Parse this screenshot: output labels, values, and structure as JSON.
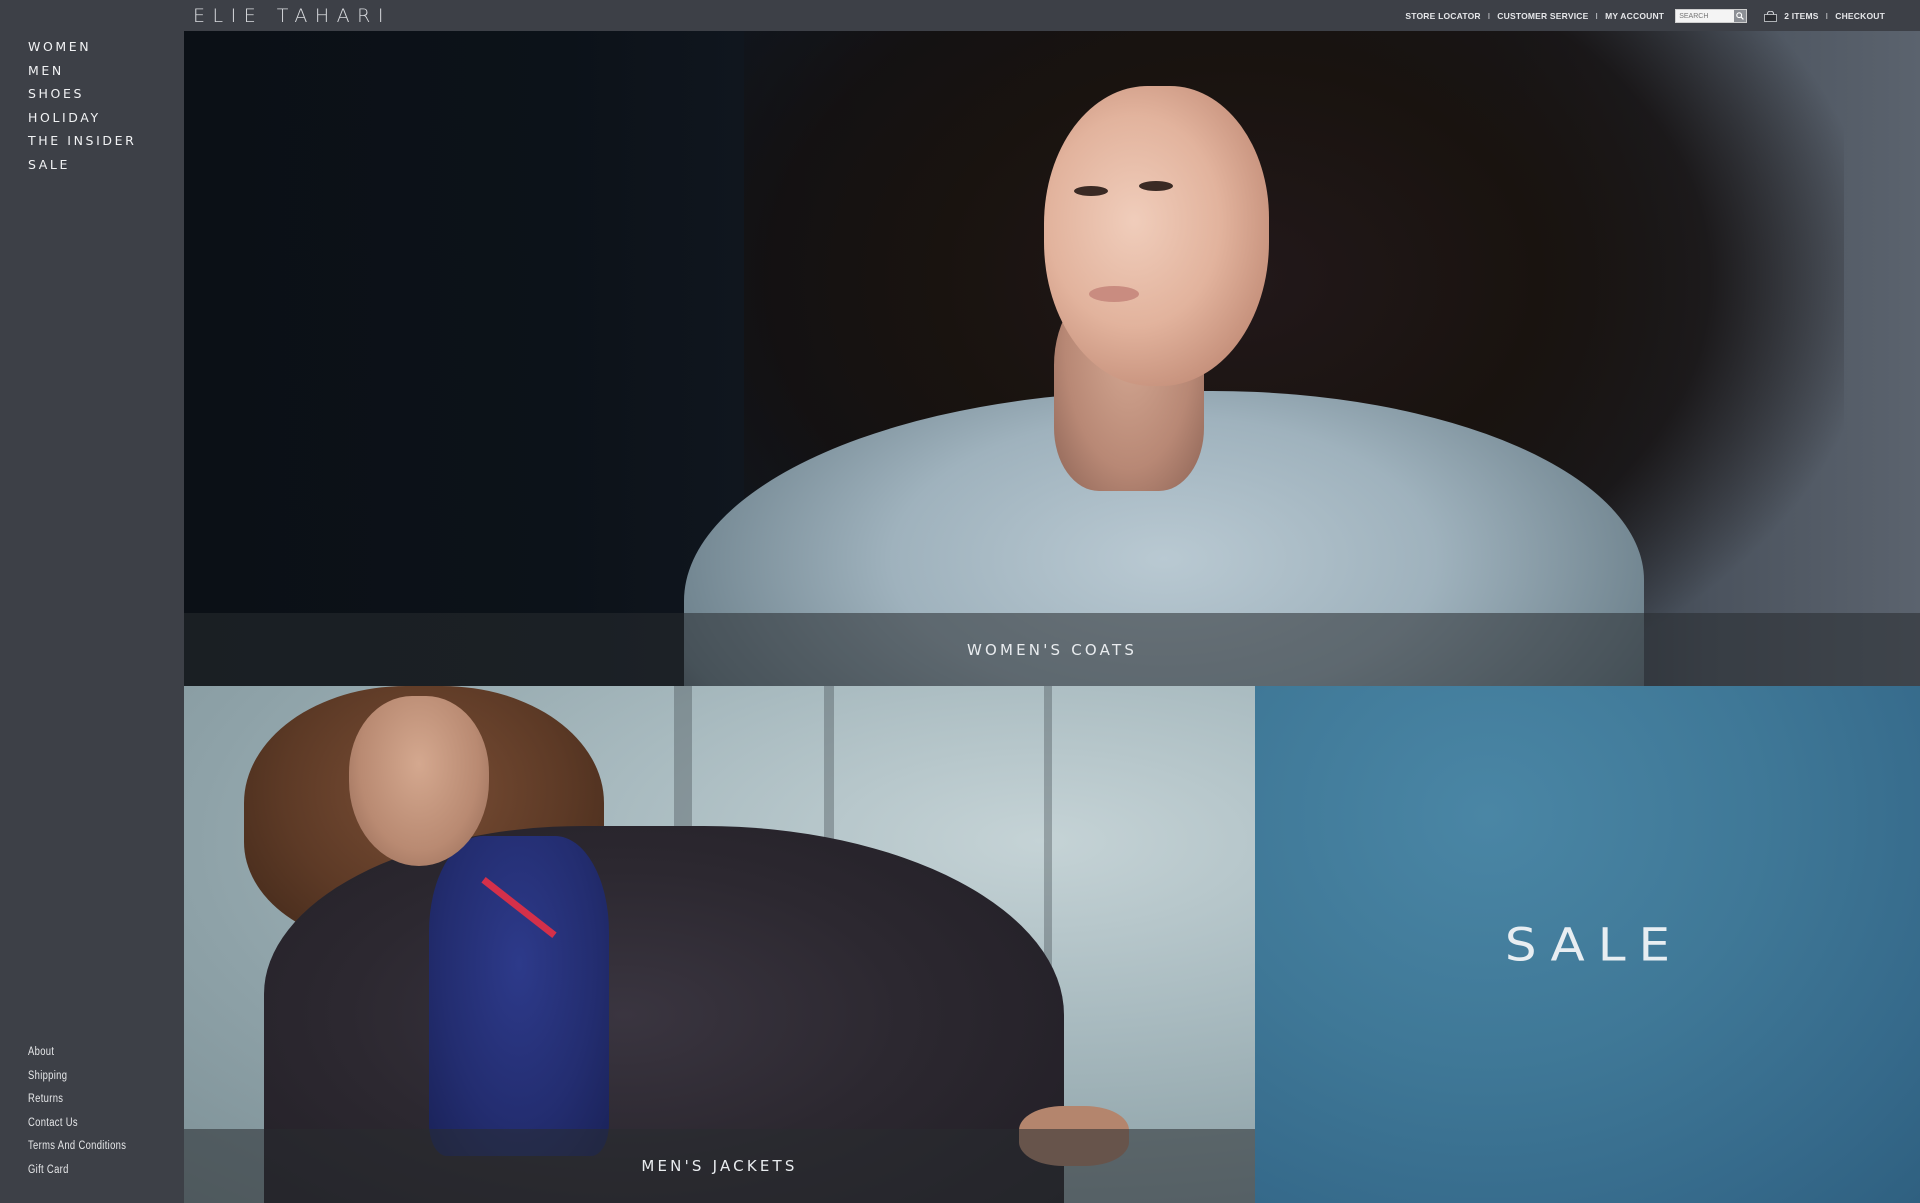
{
  "brand": {
    "logo": "ELIE TAHARI"
  },
  "utility_nav": {
    "store_locator": "STORE LOCATOR",
    "customer_service": "CUSTOMER SERVICE",
    "my_account": "MY ACCOUNT",
    "separator": "I",
    "search_placeholder": "SEARCH",
    "cart_items": "2 ITEMS",
    "checkout": "CHECKOUT"
  },
  "main_nav": [
    "WOMEN",
    "MEN",
    "SHOES",
    "HOLIDAY",
    "THE INSIDER",
    "SALE"
  ],
  "footer_nav": [
    "About",
    "Shipping",
    "Returns",
    "Contact Us",
    "Terms And Conditions",
    "Gift Card"
  ],
  "promos": {
    "womens_coats": "WOMEN'S COATS",
    "mens_jackets": "MEN'S JACKETS",
    "sale": "SALE"
  },
  "icons": {
    "search": "magnifier-icon",
    "cart": "shopping-bag-icon"
  },
  "colors": {
    "chrome": "#3d4047",
    "sale_panel": "#3f7897",
    "text_light": "#f1f2f4"
  }
}
